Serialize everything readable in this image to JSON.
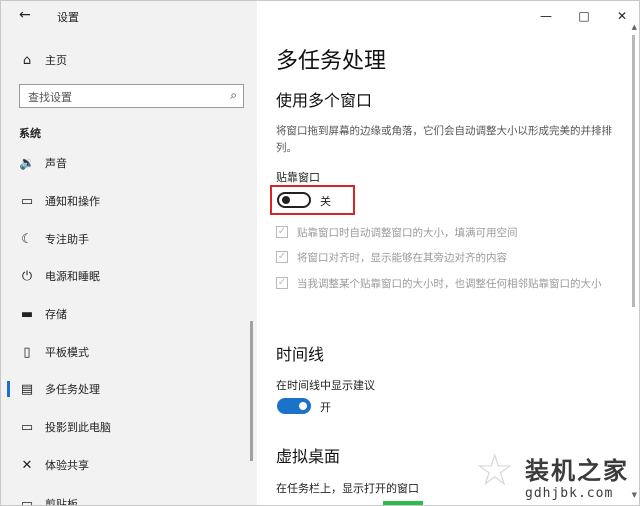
{
  "app": {
    "back_icon": "←",
    "title": "设置",
    "controls": {
      "minimize": "—",
      "maximize": "□",
      "close": "✕"
    }
  },
  "sidebar": {
    "home": {
      "icon": "⌂",
      "label": "主页"
    },
    "search": {
      "placeholder": "查找设置",
      "icon": "⌕"
    },
    "section": "系统",
    "items": [
      {
        "icon": "🔉",
        "label": "声音"
      },
      {
        "icon": "▭",
        "label": "通知和操作"
      },
      {
        "icon": "☾",
        "label": "专注助手"
      },
      {
        "icon": "⏻",
        "label": "电源和睡眠"
      },
      {
        "icon": "▬",
        "label": "存储"
      },
      {
        "icon": "▯",
        "label": "平板模式"
      },
      {
        "icon": "▤",
        "label": "多任务处理"
      },
      {
        "icon": "▭",
        "label": "投影到此电脑"
      },
      {
        "icon": "✕",
        "label": "体验共享"
      },
      {
        "icon": "▭",
        "label": "剪贴板"
      }
    ]
  },
  "main": {
    "title": "多任务处理",
    "snap": {
      "heading": "使用多个窗口",
      "description": "将窗口拖到屏幕的边缘或角落，它们会自动调整大小以形成完美的并排排列。",
      "toggle_title": "贴靠窗口",
      "toggle_state": "关",
      "options": [
        "贴靠窗口时自动调整窗口的大小，填满可用空间",
        "将窗口对齐时，显示能够在其旁边对齐的内容",
        "当我调整某个贴靠窗口的大小时，也调整任何相邻贴靠窗口的大小"
      ]
    },
    "timeline": {
      "heading": "时间线",
      "subtitle": "在时间线中显示建议",
      "toggle_state": "开"
    },
    "virtual_desktops": {
      "heading": "虚拟桌面",
      "subtitle": "在任务栏上，显示打开的窗口"
    }
  },
  "watermark": {
    "main": "装机之家",
    "sub": "gdhjbk.com"
  },
  "colors": {
    "accent": "#1a73c8",
    "highlight": "#d9252a"
  }
}
